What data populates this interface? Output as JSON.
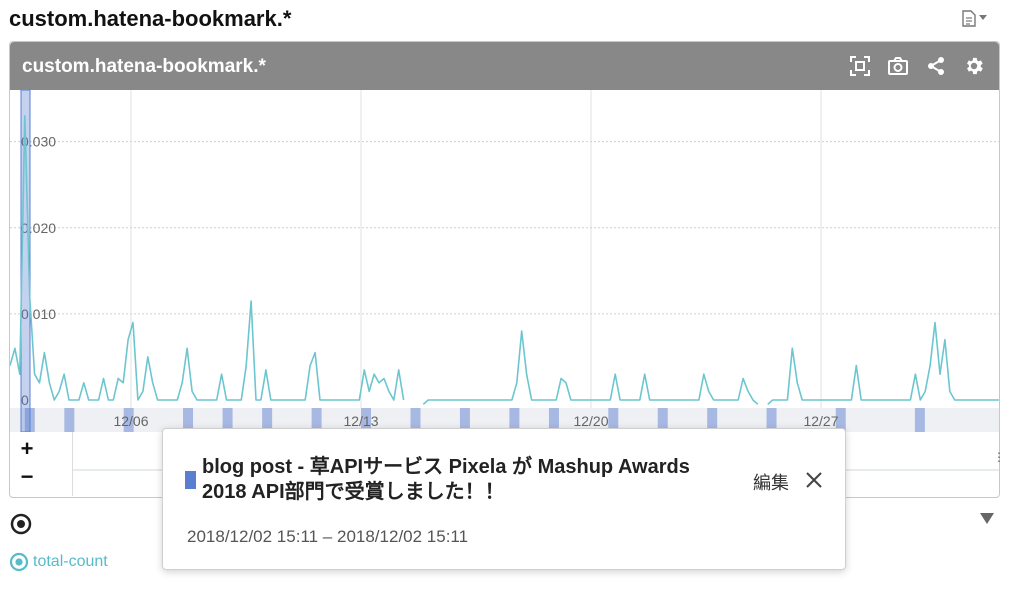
{
  "page": {
    "title": "custom.hatena-bookmark.*"
  },
  "panel": {
    "title": "custom.hatena-bookmark.*",
    "icons": [
      "focus-frame-icon",
      "camera-icon",
      "share-icon",
      "gear-icon"
    ]
  },
  "chart_data": {
    "type": "line",
    "ylim": [
      0,
      0.036
    ],
    "y_ticks": [
      {
        "value": 0,
        "label": "0"
      },
      {
        "value": 0.01,
        "label": "0.010"
      },
      {
        "value": 0.02,
        "label": "0.020"
      },
      {
        "value": 0.03,
        "label": "0.030"
      }
    ],
    "x_ticks": [
      "12/06",
      "12/13",
      "12/20",
      "12/27"
    ],
    "series": [
      {
        "name": "total-count",
        "color": "#6cc6cf",
        "values": [
          0.004,
          0.006,
          0.003,
          0.033,
          0.012,
          0.003,
          0.002,
          0.0055,
          0.002,
          0,
          0.001,
          0.003,
          0,
          0,
          0,
          0.002,
          0,
          0,
          0,
          0.0025,
          0,
          0,
          0.0025,
          0.002,
          0.007,
          0.009,
          0,
          0.001,
          0.005,
          0.002,
          0,
          0,
          0,
          0,
          0,
          0.002,
          0.006,
          0.001,
          0,
          0,
          0,
          0,
          0,
          0.003,
          0,
          0,
          0,
          0,
          0.004,
          0.0115,
          0,
          0,
          0.0035,
          0,
          0,
          0,
          0,
          0,
          0,
          0,
          0,
          0.004,
          0.0055,
          0,
          0,
          0,
          0,
          0,
          0,
          0,
          0,
          0,
          0.0035,
          0.001,
          0.003,
          0.002,
          0.0025,
          0.001,
          0,
          0.0035,
          0,
          null,
          null,
          null,
          -0.0005,
          0,
          0,
          0,
          0,
          0,
          0,
          0,
          0,
          0,
          0,
          0,
          0,
          0,
          0,
          0,
          0,
          0,
          0,
          0.002,
          0.008,
          0.003,
          0,
          0,
          0,
          0,
          0,
          0,
          0.0025,
          0.002,
          0,
          0,
          0,
          0,
          0,
          0,
          0,
          0,
          0,
          0.003,
          0,
          0,
          0,
          0,
          0,
          0.003,
          0,
          0,
          0,
          0,
          0,
          0,
          0,
          0,
          0,
          0,
          0,
          0.003,
          0.001,
          0,
          0,
          0,
          0,
          0,
          0,
          0.0025,
          0.001,
          0,
          -0.0005,
          null,
          -0.0005,
          0,
          0,
          0,
          0,
          0.006,
          0.002,
          0,
          0,
          0,
          0,
          0,
          0,
          0,
          0,
          0,
          0,
          0,
          0.004,
          0,
          0,
          0,
          0,
          0,
          0,
          0,
          0,
          0,
          0,
          0,
          0.003,
          0,
          0.001,
          0.004,
          0.009,
          0.003,
          0.007,
          0.001,
          0,
          0,
          0,
          0,
          0,
          0,
          0,
          0,
          0,
          0
        ]
      }
    ],
    "annotation_bands": [
      0.02,
      0.06,
      0.12,
      0.18,
      0.22,
      0.26,
      0.31,
      0.36,
      0.41,
      0.46,
      0.51,
      0.55,
      0.61,
      0.66,
      0.71,
      0.77,
      0.84,
      0.92
    ]
  },
  "range_nav": {
    "zoom_in": "+",
    "zoom_out": "−"
  },
  "legend": {
    "label": "total-count"
  },
  "popover": {
    "title": "blog post - 草APIサービス Pixela が Mashup Awards 2018 API部門で受賞しました！！",
    "edit_label": "編集",
    "time_range": "2018/12/02 15:11 – 2018/12/02 15:11",
    "swatch_color": "#5a7fd1"
  }
}
